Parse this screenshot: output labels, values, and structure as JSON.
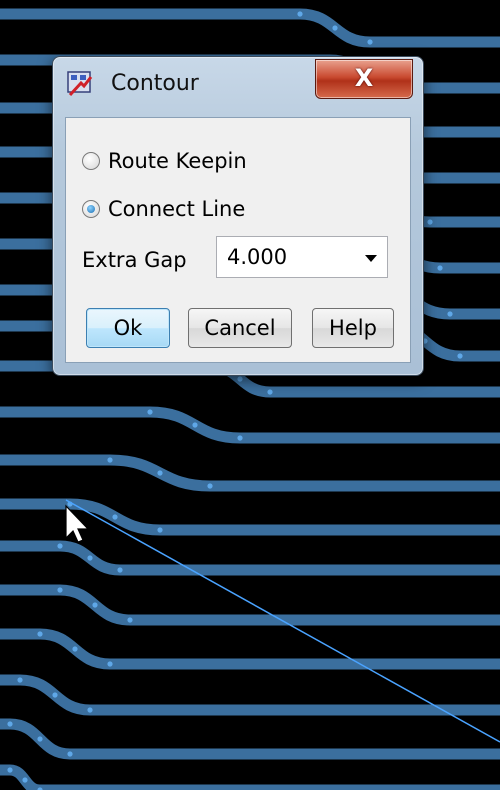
{
  "dialog": {
    "title": "Contour",
    "close_glyph": "X",
    "icon": "contour-app-icon",
    "options": [
      {
        "label": "Route Keepin",
        "checked": false
      },
      {
        "label": "Connect Line",
        "checked": true
      }
    ],
    "extra_gap": {
      "label": "Extra Gap",
      "value": "4.000"
    },
    "buttons": {
      "ok": "Ok",
      "cancel": "Cancel",
      "help": "Help"
    }
  },
  "colors": {
    "background": "#000000",
    "trace": "#3b6f9e",
    "via": "#5fa8e8",
    "ratsnest": "#4aa3ff"
  }
}
